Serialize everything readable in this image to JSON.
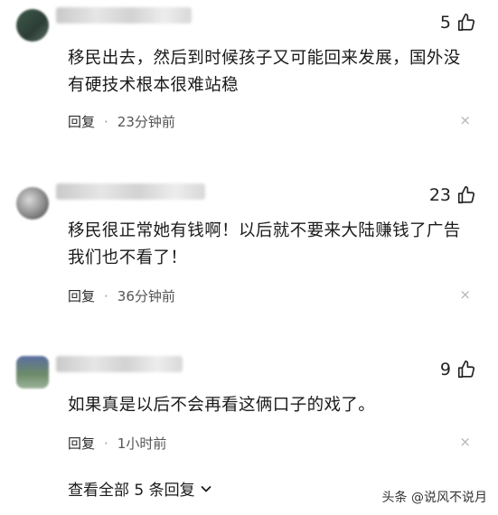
{
  "comments": [
    {
      "likes": "5",
      "text": "移民出去，然后到时候孩子又可能回来发展，国外没有硬技术根本很难站稳",
      "reply_label": "回复",
      "time": "23分钟前",
      "close": "×"
    },
    {
      "likes": "23",
      "text": "移民很正常她有钱啊！以后就不要来大陆赚钱了广告我们也不看了！",
      "reply_label": "回复",
      "time": "36分钟前",
      "close": "×"
    },
    {
      "likes": "9",
      "text": "如果真是以后不会再看这俩口子的戏了。",
      "reply_label": "回复",
      "time": "1小时前",
      "close": "×"
    }
  ],
  "view_all": "查看全部 5 条回复",
  "watermark": "头条 @说风不说月",
  "separator": "·",
  "icons": {
    "like": "thumbs-up-icon",
    "expand": "chevron-down-icon"
  }
}
